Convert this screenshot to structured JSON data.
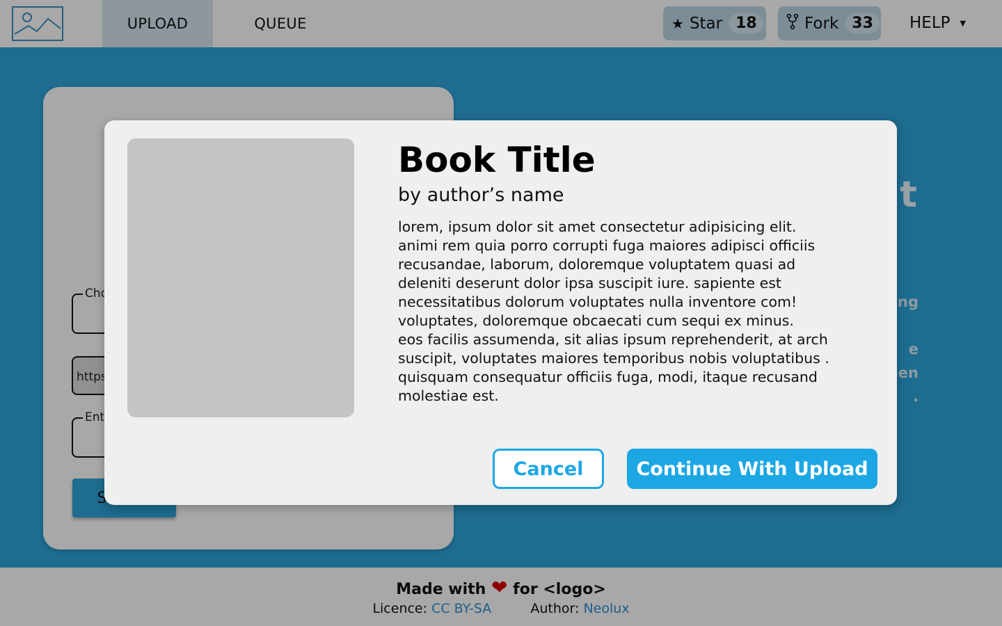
{
  "nav": {
    "tabs": [
      {
        "label": "UPLOAD",
        "active": true
      },
      {
        "label": "QUEUE",
        "active": false
      }
    ],
    "star": {
      "label": "Star",
      "count": "18"
    },
    "fork": {
      "label": "Fork",
      "count": "33"
    },
    "help": {
      "label": "HELP"
    }
  },
  "form": {
    "choose_legend": "Cho",
    "url_value": "https",
    "enter_legend": "Ente",
    "submit_label": "Submit"
  },
  "right_text": {
    "title_fragment": "t",
    "line1_fragment": "ng",
    "line2_fragment": "e",
    "line3_fragment": "en",
    "line4_fragment": "."
  },
  "footer": {
    "made_with_prefix": "Made with",
    "made_with_suffix": "for <logo>",
    "licence_label": "Licence:",
    "licence_link": "CC BY-SA",
    "author_label": "Author:",
    "author_link": "Neolux"
  },
  "modal": {
    "title": "Book Title",
    "author": "by author’s name",
    "description_lines": [
      "lorem, ipsum dolor sit amet consectetur adipisicing elit.",
      "animi rem quia porro corrupti fuga maiores adipisci officiis",
      "recusandae, laborum, doloremque voluptatem quasi ad",
      "deleniti deserunt dolor ipsa suscipit iure. sapiente est",
      "necessitatibus dolorum voluptates nulla inventore com!",
      "voluptates, doloremque obcaecati cum sequi ex minus.",
      "eos facilis assumenda, sit alias ipsum reprehenderit, at arch",
      "suscipit, voluptates maiores temporibus nobis voluptatibus .",
      "quisquam consequatur officiis fuga, modi, itaque recusand",
      "molestiae est."
    ],
    "cancel_label": "Cancel",
    "continue_label": "Continue With Upload"
  },
  "colors": {
    "accent": "#1ca7e4",
    "main_background": "#2ea4d9",
    "heart": "#d60000",
    "link": "#2f8fcf"
  },
  "icons": {
    "logo": "image-placeholder-icon",
    "star": "star-icon",
    "fork": "fork-icon",
    "help_caret": "caret-down-icon",
    "heart": "heart-icon"
  }
}
